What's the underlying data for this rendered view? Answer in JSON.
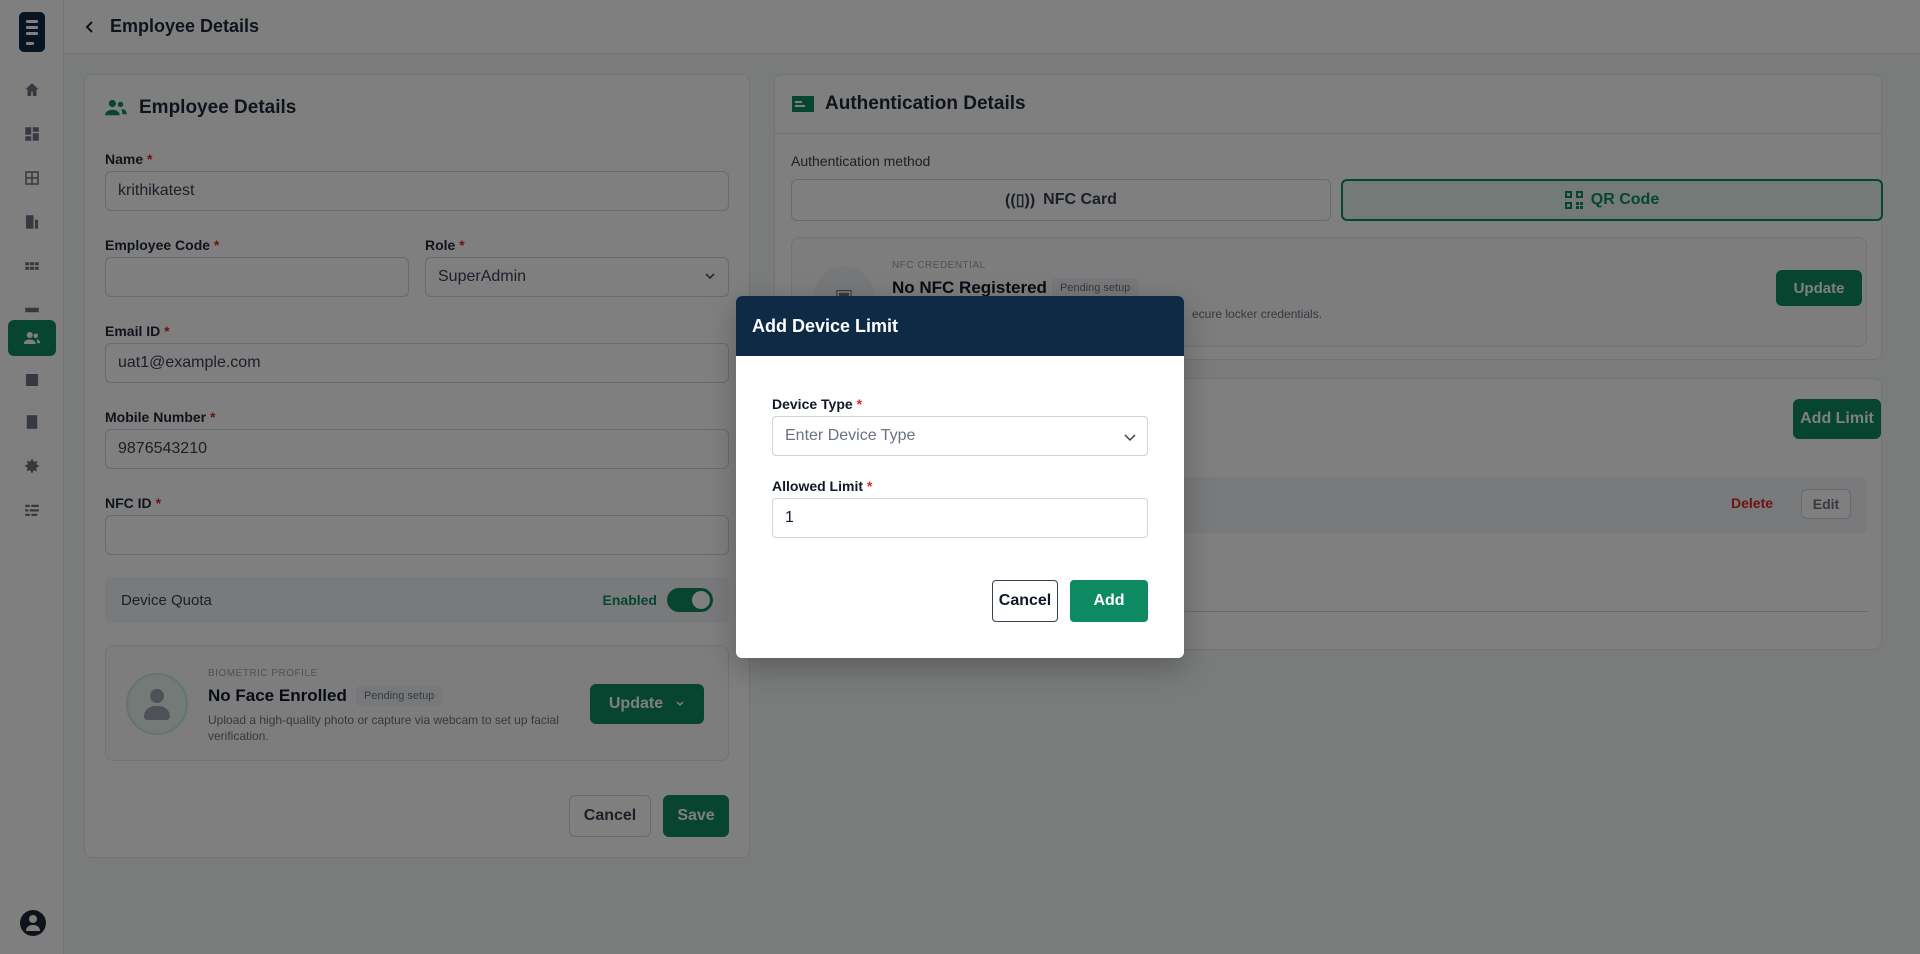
{
  "header": {
    "title": "Employee Details",
    "back_icon": "chevron-left-icon"
  },
  "sidebar": {
    "items": [
      {
        "name": "home",
        "icon": "home-icon"
      },
      {
        "name": "dashboard",
        "icon": "dashboard-icon"
      },
      {
        "name": "lockers",
        "icon": "locker-grid-icon"
      },
      {
        "name": "buildings",
        "icon": "building-icon"
      },
      {
        "name": "apps",
        "icon": "apps-icon"
      },
      {
        "name": "devices",
        "icon": "device-icon"
      },
      {
        "name": "employees",
        "icon": "users-icon",
        "active": true
      },
      {
        "name": "reports",
        "icon": "report-icon"
      },
      {
        "name": "documents",
        "icon": "document-icon"
      },
      {
        "name": "settings",
        "icon": "gear-icon"
      },
      {
        "name": "logs",
        "icon": "list-icon"
      }
    ],
    "profile_icon": "user-avatar-icon"
  },
  "employee": {
    "title": "Employee Details",
    "name_label": "Name",
    "name_value": "krithikatest",
    "code_label": "Employee Code",
    "code_value": "",
    "role_label": "Role",
    "role_value": "SuperAdmin",
    "email_label": "Email ID",
    "email_value": "uat1@example.com",
    "mobile_label": "Mobile Number",
    "mobile_value": "9876543210",
    "nfc_label": "NFC ID",
    "nfc_value": "",
    "required_mark": "*",
    "quota_label": "Device Quota",
    "quota_status": "Enabled",
    "quota_enabled": true,
    "bio_caption": "BIOMETRIC PROFILE",
    "bio_title": "No Face Enrolled",
    "bio_badge": "Pending setup",
    "bio_help": "Upload a high-quality photo or capture via webcam to set up facial verification.",
    "bio_update": "Update",
    "cancel": "Cancel",
    "save": "Save"
  },
  "auth": {
    "title": "Authentication Details",
    "method_label": "Authentication method",
    "methods": [
      "NFC Card",
      "QR Code"
    ],
    "selected_method": "QR Code",
    "nfc_caption": "NFC CREDENTIAL",
    "nfc_title": "No NFC Registered",
    "nfc_badge": "Pending setup",
    "nfc_help": "ecure locker credentials.",
    "nfc_update": "Update"
  },
  "quota_panel": {
    "add_limit": "Add Limit",
    "delete": "Delete",
    "edit": "Edit"
  },
  "modal": {
    "title": "Add Device Limit",
    "device_type_label": "Device Type",
    "device_type_placeholder": "Enter Device Type",
    "allowed_limit_label": "Allowed Limit",
    "allowed_limit_value": "1",
    "required_mark": "*",
    "cancel": "Cancel",
    "add": "Add"
  },
  "colors": {
    "accent": "#0e8a62",
    "modal_header": "#0f2a44",
    "danger": "#dc2626"
  }
}
